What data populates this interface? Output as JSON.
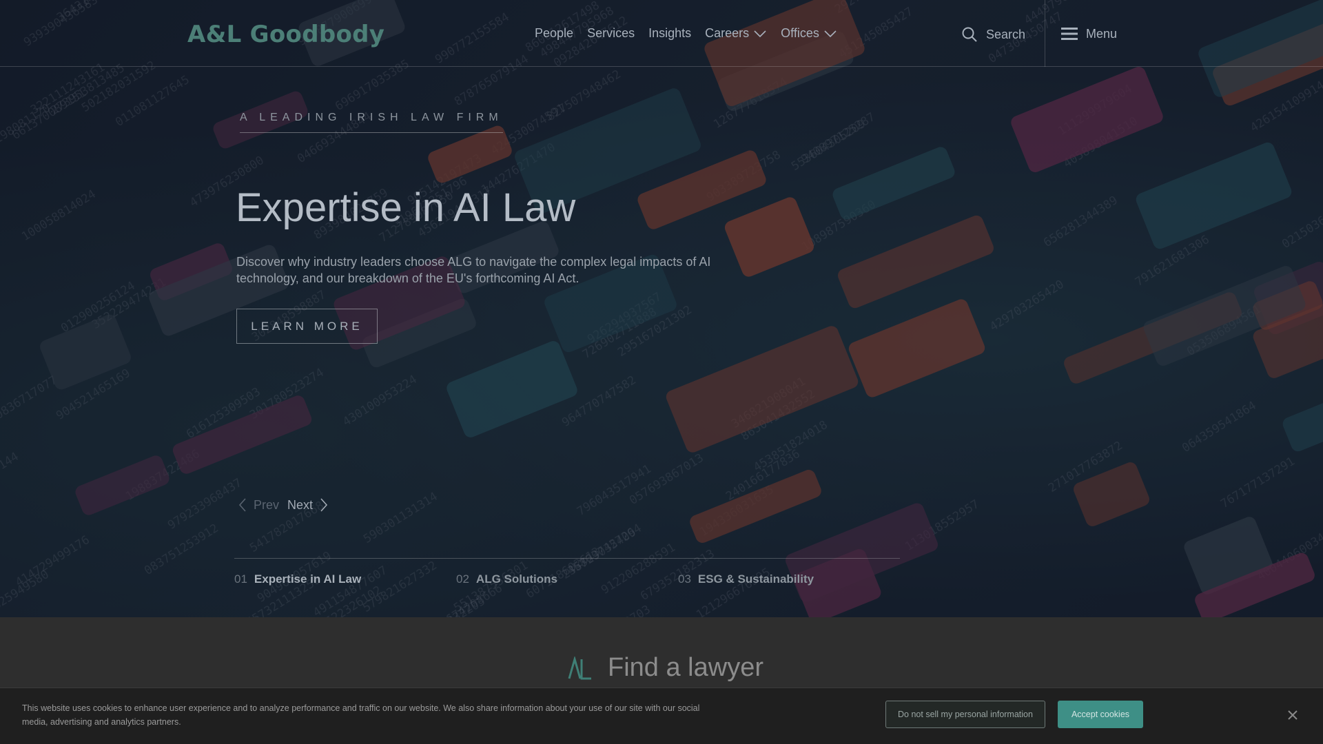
{
  "header": {
    "logo": "A&L Goodbody",
    "nav": [
      {
        "label": "People",
        "has_dropdown": false
      },
      {
        "label": "Services",
        "has_dropdown": false
      },
      {
        "label": "Insights",
        "has_dropdown": false
      },
      {
        "label": "Careers",
        "has_dropdown": true
      },
      {
        "label": "Offices",
        "has_dropdown": true
      }
    ],
    "search_label": "Search",
    "menu_label": "Menu"
  },
  "hero": {
    "eyebrow": "A LEADING IRISH LAW FIRM",
    "title": "Expertise in AI Law",
    "description": "Discover why industry leaders choose ALG to navigate the complex legal impacts of AI technology, and our breakdown of the EU's forthcoming AI Act.",
    "cta_label": "LEARN MORE",
    "prev_label": "Prev",
    "next_label": "Next",
    "slides": [
      {
        "num": "01",
        "label": "Expertise in AI Law",
        "active": true
      },
      {
        "num": "02",
        "label": "ALG Solutions",
        "active": false
      },
      {
        "num": "03",
        "label": "ESG & Sustainability",
        "active": false
      }
    ]
  },
  "find_lawyer": {
    "title": "Find a lawyer"
  },
  "cookie_banner": {
    "text": "This website uses cookies to enhance user experience and to analyze performance and traffic on our website. We also share information about your use of our site with our social media, advertising and analytics partners.",
    "dns_label": "Do not sell my personal information",
    "accept_label": "Accept cookies"
  },
  "colors": {
    "brand_green": "#4c7f77",
    "accept_button": "#3e8f86"
  },
  "icons": [
    "search-icon",
    "menu-icon",
    "chevron-down-icon",
    "chevron-left-icon",
    "chevron-right-icon",
    "alg-mark-icon",
    "close-icon"
  ]
}
